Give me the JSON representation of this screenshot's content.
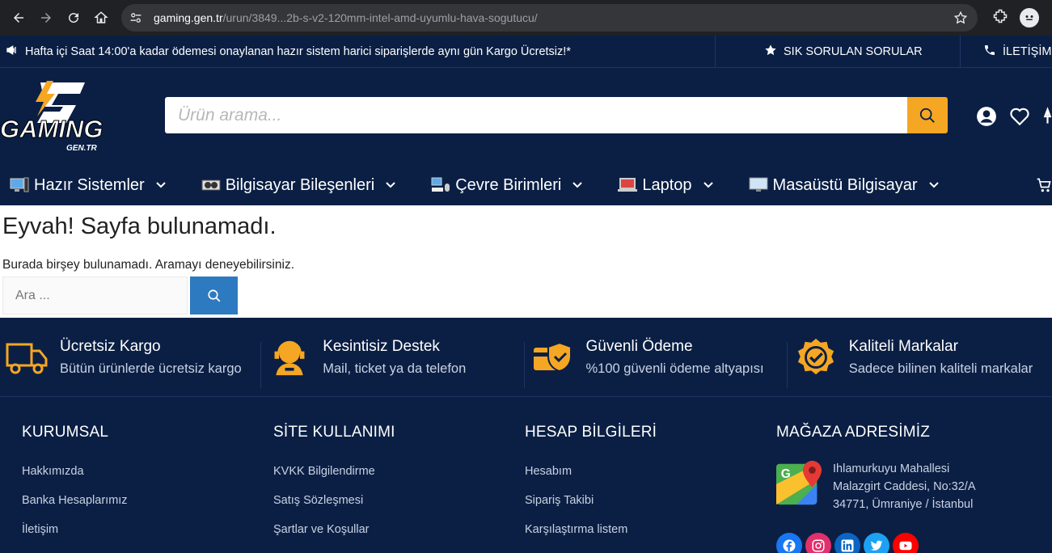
{
  "browser": {
    "url_host": "gaming.gen.tr",
    "url_path": "/urun/3849...2b-s-v2-120mm-intel-amd-uyumlu-hava-sogutucu/"
  },
  "topbar": {
    "announcement": "Hafta içi Saat 14:00'a kadar ödemesi onaylanan hazır sistem harici siparişlerde aynı gün Kargo Ücretsiz!*",
    "faq": "SIK SORULAN SORULAR",
    "contact": "İLETİŞİM"
  },
  "header": {
    "logo_text": "GAMING",
    "logo_sub": "GEN.TR",
    "search_placeholder": "Ürün arama..."
  },
  "nav": [
    {
      "label": "Hazır Sistemler",
      "icon": "desktop-system-icon"
    },
    {
      "label": "Bilgisayar Bileşenleri",
      "icon": "gpu-icon"
    },
    {
      "label": "Çevre Birimleri",
      "icon": "peripherals-icon"
    },
    {
      "label": "Laptop",
      "icon": "laptop-icon"
    },
    {
      "label": "Masaüstü Bilgisayar",
      "icon": "monitor-icon"
    }
  ],
  "notfound": {
    "title": "Eyvah! Sayfa bulunamadı.",
    "message": "Burada birşey bulunamadı. Aramayı deneyebilirsiniz.",
    "search_placeholder": "Ara ..."
  },
  "features": [
    {
      "title": "Ücretsiz Kargo",
      "sub": "Bütün ürünlerde ücretsiz kargo",
      "icon": "truck-icon"
    },
    {
      "title": "Kesintisiz Destek",
      "sub": "Mail, ticket ya da telefon",
      "icon": "support-agent-icon"
    },
    {
      "title": "Güvenli Ödeme",
      "sub": "%100 güvenli ödeme altyapısı",
      "icon": "secure-card-icon"
    },
    {
      "title": "Kaliteli Markalar",
      "sub": "Sadece bilinen kaliteli markalar",
      "icon": "quality-badge-icon"
    }
  ],
  "footer": {
    "corporate": {
      "title": "KURUMSAL",
      "links": [
        "Hakkımızda",
        "Banka Hesaplarımız",
        "İletişim"
      ]
    },
    "usage": {
      "title": "SİTE KULLANIMI",
      "links": [
        "KVKK Bilgilendirme",
        "Satış Sözleşmesi",
        "Şartlar ve Koşullar"
      ]
    },
    "account": {
      "title": "HESAP BİLGİLERİ",
      "links": [
        "Hesabım",
        "Sipariş Takibi",
        "Karşılaştırma listem"
      ]
    },
    "store": {
      "title": "MAĞAZA ADRESİMİZ",
      "address": [
        "Ihlamurkuyu Mahallesi",
        "Malazgirt Caddesi, No:32/A",
        "34771, Ümraniye / İstanbul"
      ]
    }
  },
  "colors": {
    "navy": "#0b1f44",
    "accent": "#f5a623",
    "search_blue": "#2e7ac1"
  }
}
